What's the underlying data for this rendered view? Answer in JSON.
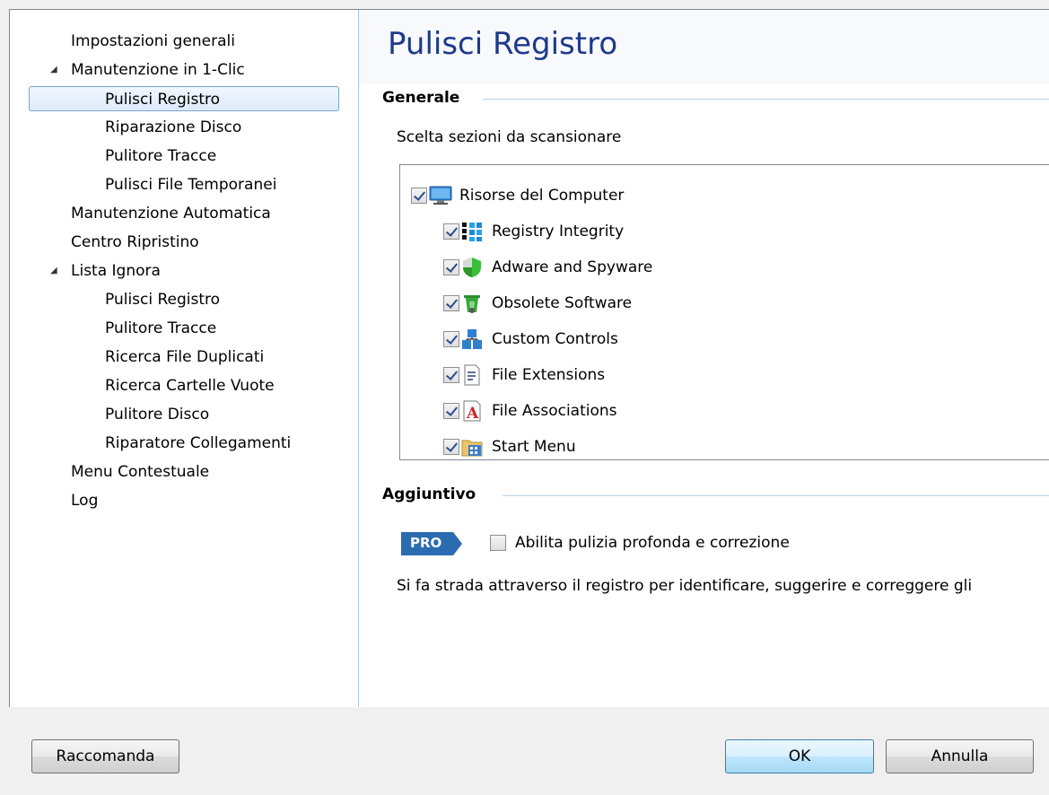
{
  "sidebar": {
    "items": [
      {
        "label": "Impostazioni generali"
      },
      {
        "label": "Manutenzione in 1-Clic"
      },
      {
        "label": "Pulisci Registro"
      },
      {
        "label": "Riparazione Disco"
      },
      {
        "label": "Pulitore Tracce"
      },
      {
        "label": "Pulisci File Temporanei"
      },
      {
        "label": "Manutenzione Automatica"
      },
      {
        "label": "Centro Ripristino"
      },
      {
        "label": "Lista Ignora"
      },
      {
        "label": "Pulisci Registro"
      },
      {
        "label": "Pulitore Tracce"
      },
      {
        "label": "Ricerca File Duplicati"
      },
      {
        "label": "Ricerca Cartelle Vuote"
      },
      {
        "label": "Pulitore Disco"
      },
      {
        "label": "Riparatore Collegamenti"
      },
      {
        "label": "Menu Contestuale"
      },
      {
        "label": "Log"
      }
    ],
    "expander_glyph": "◢"
  },
  "main": {
    "title": "Pulisci Registro",
    "general": {
      "heading": "Generale",
      "description": "Scelta sezioni da scansionare",
      "tree": {
        "root": {
          "label": "Risorse del Computer",
          "checked": true,
          "icon": "computer-icon"
        },
        "children": [
          {
            "label": "Registry Integrity",
            "checked": true,
            "icon": "registry-icon"
          },
          {
            "label": "Adware and Spyware",
            "checked": true,
            "icon": "shield-icon"
          },
          {
            "label": "Obsolete Software",
            "checked": true,
            "icon": "recycle-bin-icon"
          },
          {
            "label": "Custom Controls",
            "checked": true,
            "icon": "controls-icon"
          },
          {
            "label": "File Extensions",
            "checked": true,
            "icon": "file-extension-icon"
          },
          {
            "label": "File Associations",
            "checked": true,
            "icon": "file-association-icon"
          },
          {
            "label": "Start Menu",
            "checked": true,
            "icon": "start-menu-icon"
          }
        ]
      }
    },
    "additional": {
      "heading": "Aggiuntivo",
      "pro_badge": "PRO",
      "deep_clean_label": "Abilita pulizia profonda e correzione",
      "deep_clean_checked": false,
      "description": "Si fa strada attraverso il registro per identificare, suggerire e correggere gli"
    }
  },
  "footer": {
    "recommend_label": "Raccomanda",
    "ok_label": "OK",
    "cancel_label": "Annulla"
  },
  "colors": {
    "title": "#1e3a8a",
    "selection_border": "#7da2ce",
    "pro_badge": "#2b6cb0"
  }
}
